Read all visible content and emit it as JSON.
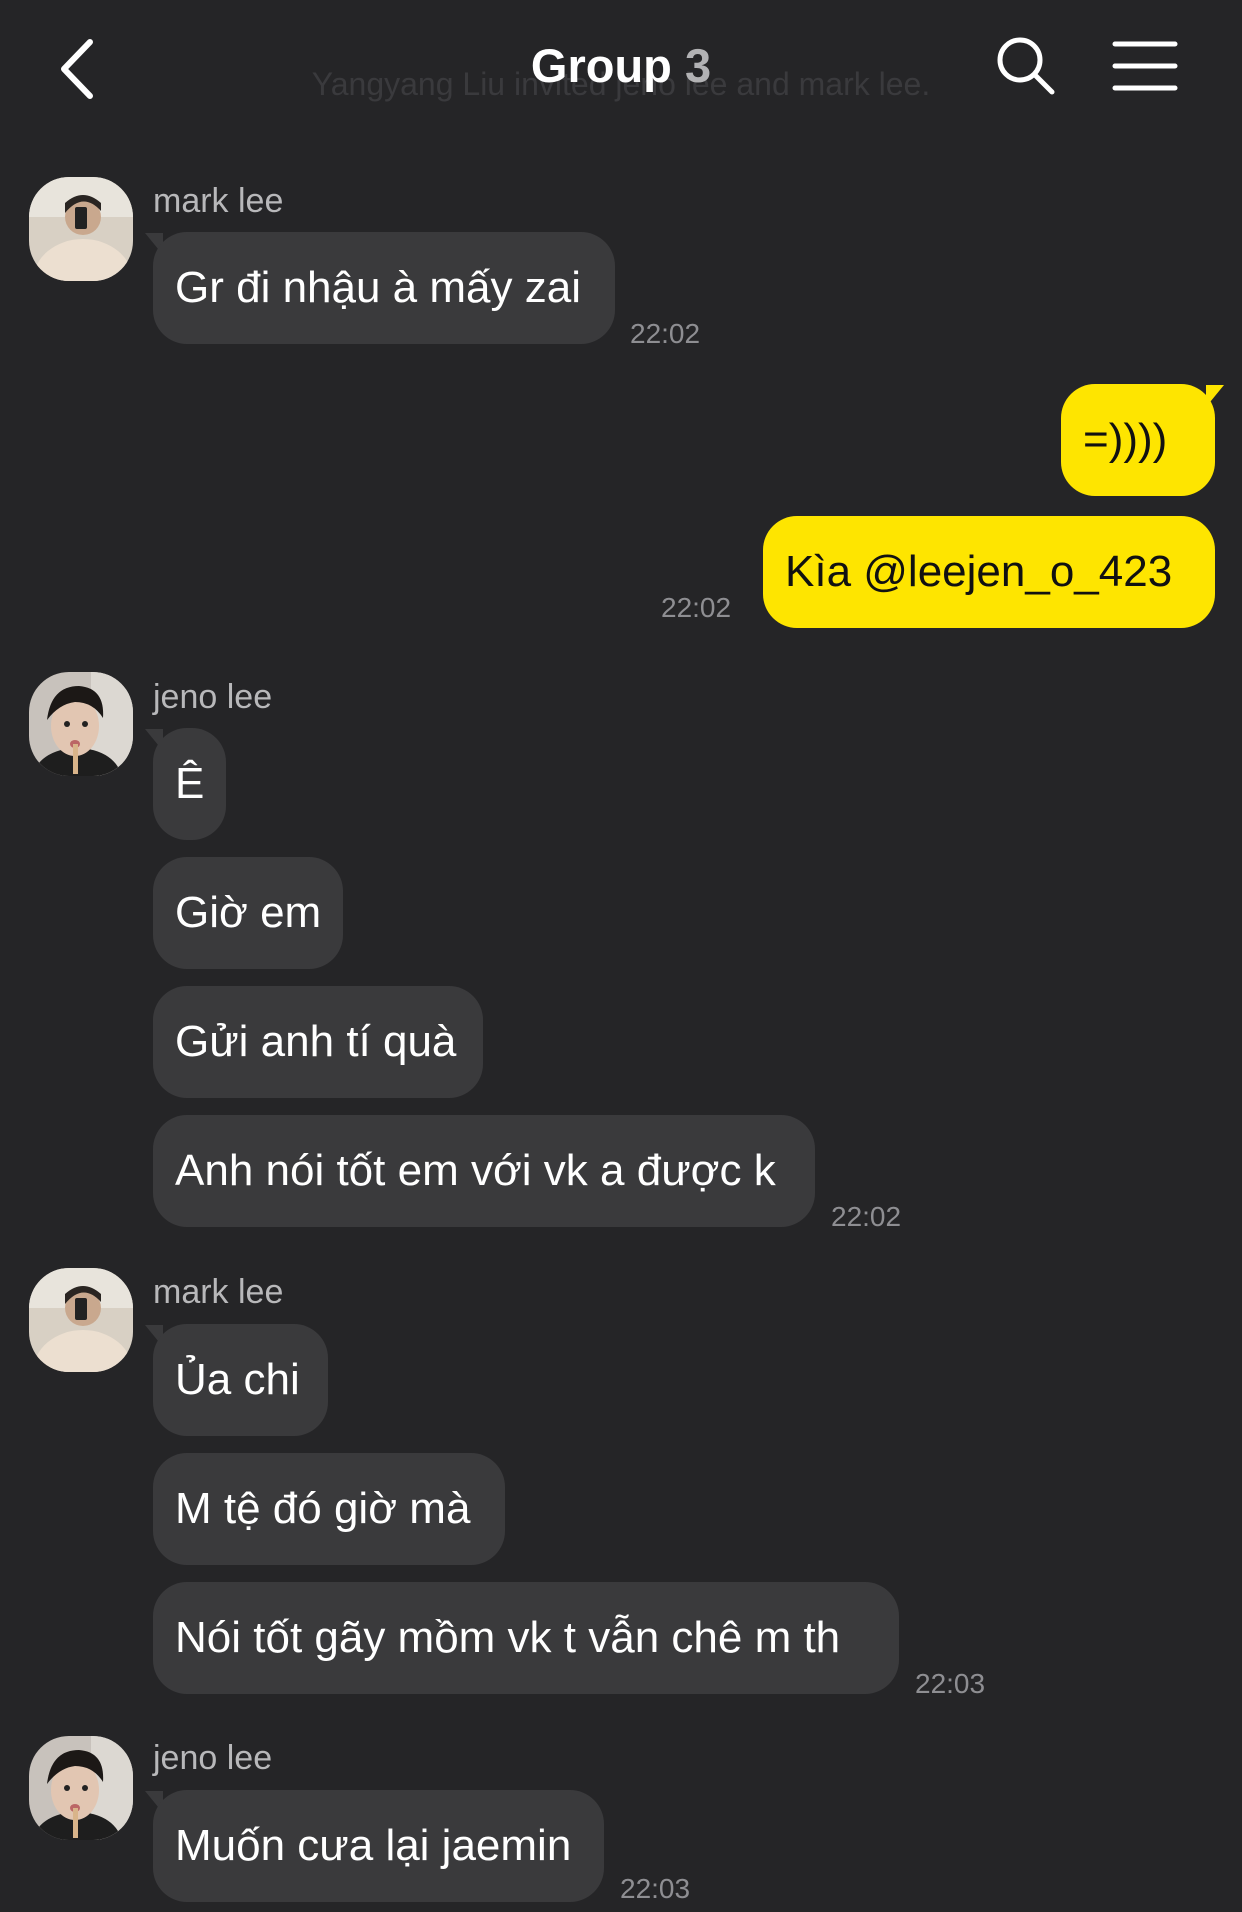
{
  "header": {
    "title": "Group",
    "member_count": "3",
    "system_message": "Yangyang Liu invited jeno lee and mark lee."
  },
  "messages": [
    {
      "sender": "mark lee",
      "bubbles": [
        "Gr đi nhậu à mấy zai"
      ],
      "time": "22:02"
    },
    {
      "sender": "me",
      "bubbles": [
        "=))))",
        "Kìa @leejen_o_423"
      ],
      "time": "22:02"
    },
    {
      "sender": "jeno lee",
      "bubbles": [
        "Ê",
        "Giờ em",
        "Gửi anh tí quà",
        "Anh nói tốt em với vk a được k"
      ],
      "time": "22:02"
    },
    {
      "sender": "mark lee",
      "bubbles": [
        "Ủa chi",
        "M tệ đó giờ mà",
        "Nói tốt gãy mồm vk t vẫn chê m th"
      ],
      "time": "22:03"
    },
    {
      "sender": "jeno lee",
      "bubbles": [
        "Muốn cưa lại jaemin"
      ],
      "time": "22:03"
    }
  ],
  "colors": {
    "background": "#252527",
    "incoming_bubble": "#3a3a3c",
    "outgoing_bubble": "#fee500",
    "timestamp": "#8e8e92"
  },
  "icons": {
    "back": "chevron-left-icon",
    "search": "search-icon",
    "menu": "hamburger-menu-icon"
  }
}
